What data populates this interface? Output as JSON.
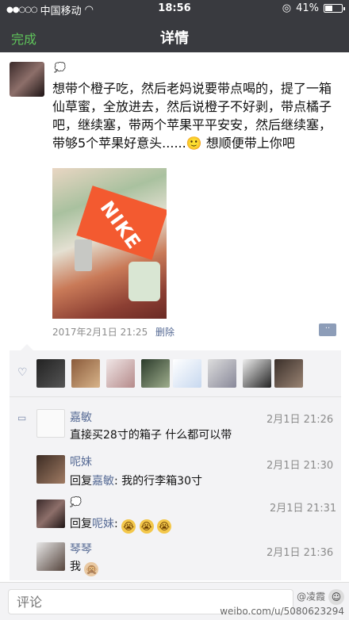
{
  "status": {
    "carrier": "中国移动",
    "time": "18:56",
    "battery": "41%"
  },
  "nav": {
    "done": "完成",
    "title": "详情"
  },
  "post": {
    "text": "想带个橙子吃，然后老妈说要带点喝的，提了一箱仙草蜜，全放进去，然后说橙子不好剥，带点橘子吧，继续塞，带两个苹果平平安安，然后继续塞，带够5个苹果好意头......🙂 想顺便带上你吧",
    "photo_brand": "NIKE",
    "time": "2017年2月1日 21:25",
    "delete": "删除",
    "more": "··"
  },
  "comments": [
    {
      "name": "嘉敏",
      "time": "2月1日 21:26",
      "text": "直接买28寸的箱子 什么都可以带"
    },
    {
      "name": "呢妹",
      "time": "2月1日 21:30",
      "reply_prefix": "回复",
      "reply_to": "嘉敏",
      "text": ": 我的行李箱30寸"
    },
    {
      "name": "",
      "time": "2月1日 21:31",
      "reply_prefix": "回复",
      "reply_to": "呢妹",
      "text": ":",
      "emojis": [
        "😭",
        "😭",
        "😭"
      ]
    },
    {
      "name": "琴琴",
      "time": "2月1日 21:36",
      "text": "我",
      "emoji": "🙊"
    }
  ],
  "footer": {
    "placeholder": "评论",
    "watermark_top": "@凌霞",
    "watermark_bottom": "weibo.com/u/5080623294"
  },
  "colors": {
    "nav_bg": "#393a3f",
    "accent_green": "#5fc45b",
    "link_blue": "#576b95"
  }
}
